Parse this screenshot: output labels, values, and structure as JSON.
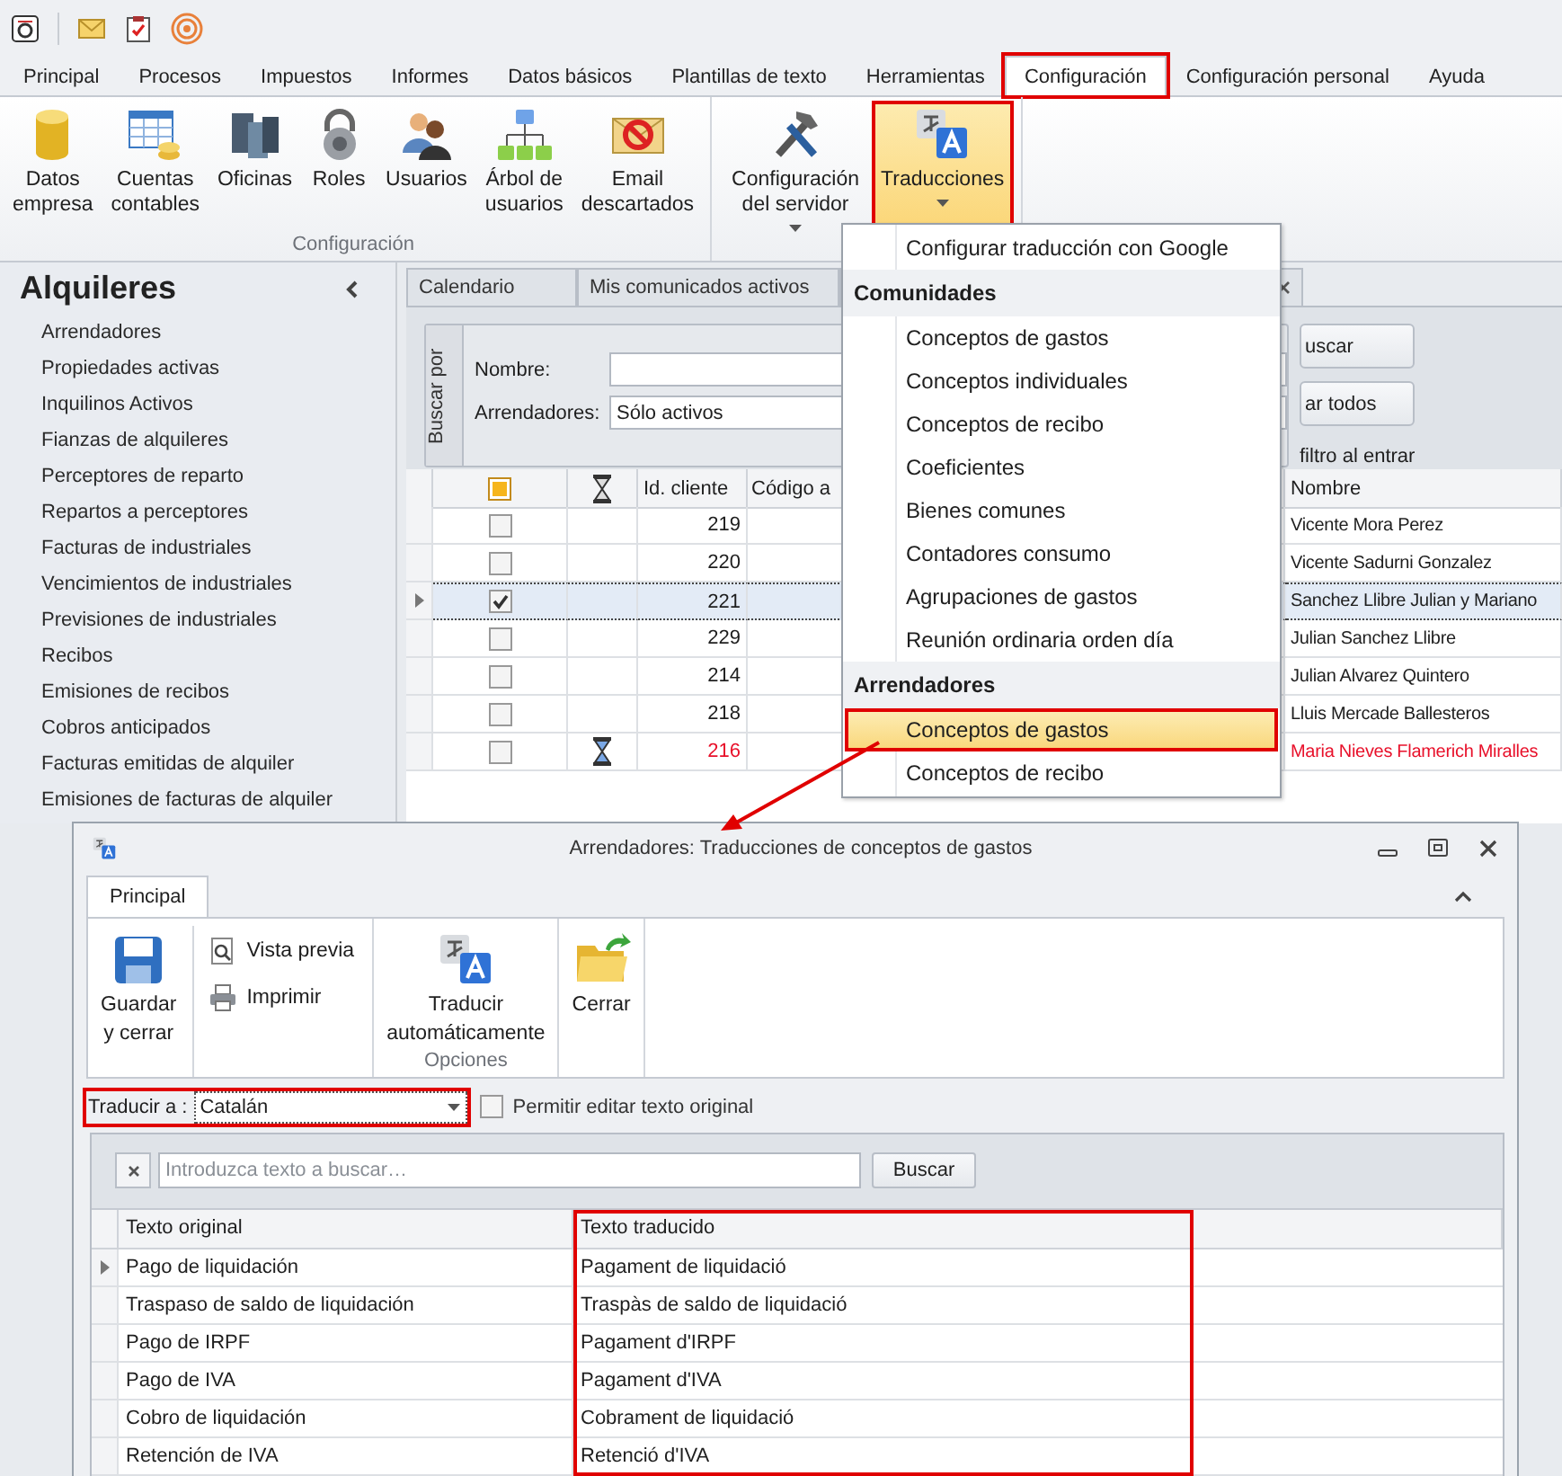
{
  "menu_tabs": [
    {
      "label": "Principal",
      "selected": false,
      "annotated": false
    },
    {
      "label": "Procesos",
      "selected": false,
      "annotated": false
    },
    {
      "label": "Impuestos",
      "selected": false,
      "annotated": false
    },
    {
      "label": "Informes",
      "selected": false,
      "annotated": false
    },
    {
      "label": "Datos básicos",
      "selected": false,
      "annotated": false
    },
    {
      "label": "Plantillas de texto",
      "selected": false,
      "annotated": false
    },
    {
      "label": "Herramientas",
      "selected": false,
      "annotated": false
    },
    {
      "label": "Configuración",
      "selected": true,
      "annotated": true
    },
    {
      "label": "Configuración personal",
      "selected": false,
      "annotated": false
    },
    {
      "label": "Ayuda",
      "selected": false,
      "annotated": false
    }
  ],
  "ribbon": {
    "groups": [
      {
        "label": "Configuración",
        "buttons": [
          {
            "lines": [
              "Datos",
              "empresa"
            ],
            "dropdown": false,
            "selected": false,
            "annotated": false
          },
          {
            "lines": [
              "Cuentas",
              "contables"
            ],
            "dropdown": false,
            "selected": false,
            "annotated": false
          },
          {
            "lines": [
              "Oficinas"
            ],
            "dropdown": false,
            "selected": false,
            "annotated": false
          },
          {
            "lines": [
              "Roles"
            ],
            "dropdown": false,
            "selected": false,
            "annotated": false
          },
          {
            "lines": [
              "Usuarios"
            ],
            "dropdown": false,
            "selected": false,
            "annotated": false
          },
          {
            "lines": [
              "Árbol de",
              "usuarios"
            ],
            "dropdown": false,
            "selected": false,
            "annotated": false
          },
          {
            "lines": [
              "Email",
              "descartados"
            ],
            "dropdown": false,
            "selected": false,
            "annotated": false
          }
        ]
      },
      {
        "buttons": [
          {
            "lines": [
              "Configuración",
              "del servidor"
            ],
            "dropdown": true,
            "selected": false,
            "annotated": false
          },
          {
            "lines": [
              "Traducciones"
            ],
            "dropdown": true,
            "selected": true,
            "annotated": true
          }
        ]
      }
    ]
  },
  "sidebar": {
    "title": "Alquileres",
    "items": [
      "Arrendadores",
      "Propiedades activas",
      "Inquilinos Activos",
      "Fianzas de alquileres",
      "Perceptores de reparto",
      "Repartos a perceptores",
      "Facturas de industriales",
      "Vencimientos de industriales",
      "Previsiones de industriales",
      "Recibos",
      "Emisiones de recibos",
      "Cobros anticipados",
      "Facturas emitidas de alquiler",
      "Emisiones de facturas de alquiler"
    ]
  },
  "doc_tabs": [
    "Calendario",
    "Mis comunicados activos"
  ],
  "search_panel": {
    "group_label": "Buscar por",
    "fields": [
      {
        "label": "Nombre:"
      },
      {
        "label": "Arrendadores:",
        "value": "Sólo activos"
      }
    ],
    "buttons": [
      "uscar",
      "ar todos"
    ],
    "option_label": "filtro al entrar"
  },
  "grid": {
    "columns": [
      "Id. cliente",
      "Código a",
      "Nombre"
    ],
    "select_all_partial": true,
    "rows": [
      {
        "id": "219",
        "name": "Vicente Mora Perez",
        "checked": false,
        "current": false,
        "overdue": false
      },
      {
        "id": "220",
        "name": "Vicente Sadurni Gonzalez",
        "checked": false,
        "current": false,
        "overdue": false
      },
      {
        "id": "221",
        "name": "Sanchez Llibre Julian y Mariano",
        "checked": true,
        "current": true,
        "overdue": false
      },
      {
        "id": "229",
        "name": "Julian Sanchez Llibre",
        "checked": false,
        "current": false,
        "overdue": false
      },
      {
        "id": "214",
        "name": "Julian Alvarez Quintero",
        "checked": false,
        "current": false,
        "overdue": false
      },
      {
        "id": "218",
        "name": "Lluis Mercade Ballesteros",
        "checked": false,
        "current": false,
        "overdue": false
      },
      {
        "id": "216",
        "name": "Maria Nieves Flamerich Miralles",
        "checked": false,
        "current": false,
        "overdue": true
      }
    ]
  },
  "menu": {
    "items": [
      {
        "kind": "item",
        "label": "Configurar traducción con Google",
        "selected": false,
        "annotated": false
      },
      {
        "kind": "header",
        "label": "Comunidades"
      },
      {
        "kind": "item",
        "label": "Conceptos de gastos",
        "selected": false,
        "annotated": false
      },
      {
        "kind": "item",
        "label": "Conceptos individuales",
        "selected": false,
        "annotated": false
      },
      {
        "kind": "item",
        "label": "Conceptos de recibo",
        "selected": false,
        "annotated": false
      },
      {
        "kind": "item",
        "label": "Coeficientes",
        "selected": false,
        "annotated": false
      },
      {
        "kind": "item",
        "label": "Bienes comunes",
        "selected": false,
        "annotated": false
      },
      {
        "kind": "item",
        "label": "Contadores consumo",
        "selected": false,
        "annotated": false
      },
      {
        "kind": "item",
        "label": "Agrupaciones de gastos",
        "selected": false,
        "annotated": false
      },
      {
        "kind": "item",
        "label": "Reunión ordinaria orden día",
        "selected": false,
        "annotated": false
      },
      {
        "kind": "header",
        "label": "Arrendadores"
      },
      {
        "kind": "item",
        "label": "Conceptos de gastos",
        "selected": true,
        "annotated": true
      },
      {
        "kind": "item",
        "label": "Conceptos de recibo",
        "selected": false,
        "annotated": false
      }
    ]
  },
  "dialog": {
    "title": "Arrendadores: Traducciones de conceptos de gastos",
    "tabs": [
      {
        "label": "Principal",
        "selected": true
      }
    ],
    "groups": [
      {
        "buttons": [
          {
            "kind": "large",
            "lines": [
              "Guardar",
              "y cerrar"
            ]
          },
          {
            "kind": "small",
            "lines": [
              "Vista previa"
            ]
          },
          {
            "kind": "small",
            "lines": [
              "Imprimir"
            ]
          }
        ]
      },
      {
        "label": "Opciones",
        "buttons": [
          {
            "kind": "large",
            "lines": [
              "Traducir",
              "automáticamente"
            ]
          }
        ]
      },
      {
        "buttons": [
          {
            "kind": "large",
            "lines": [
              "Cerrar"
            ]
          }
        ]
      }
    ],
    "translate_to": {
      "label": "Traducir a :",
      "value": "Catalán",
      "annotated": true
    },
    "allow_edit": {
      "label": "Permitir editar texto original",
      "checked": false
    },
    "search": {
      "placeholder": "Introduzca texto a buscar…",
      "button": "Buscar"
    },
    "columns": [
      {
        "label": "Texto original",
        "annotated": false
      },
      {
        "label": "Texto traducido",
        "annotated": true
      }
    ],
    "rows": [
      {
        "original": "Pago de liquidación",
        "translated": "Pagament de liquidació",
        "current": true
      },
      {
        "original": "Traspaso de saldo de liquidación",
        "translated": "Traspàs de saldo de liquidació",
        "current": false
      },
      {
        "original": "Pago de IRPF",
        "translated": "Pagament d'IRPF",
        "current": false
      },
      {
        "original": "Pago de IVA",
        "translated": "Pagament d'IVA",
        "current": false
      },
      {
        "original": "Cobro de liquidación",
        "translated": "Cobrament de liquidació",
        "current": false
      },
      {
        "original": "Retención de IVA",
        "translated": "Retenció d'IVA",
        "current": false
      }
    ]
  }
}
